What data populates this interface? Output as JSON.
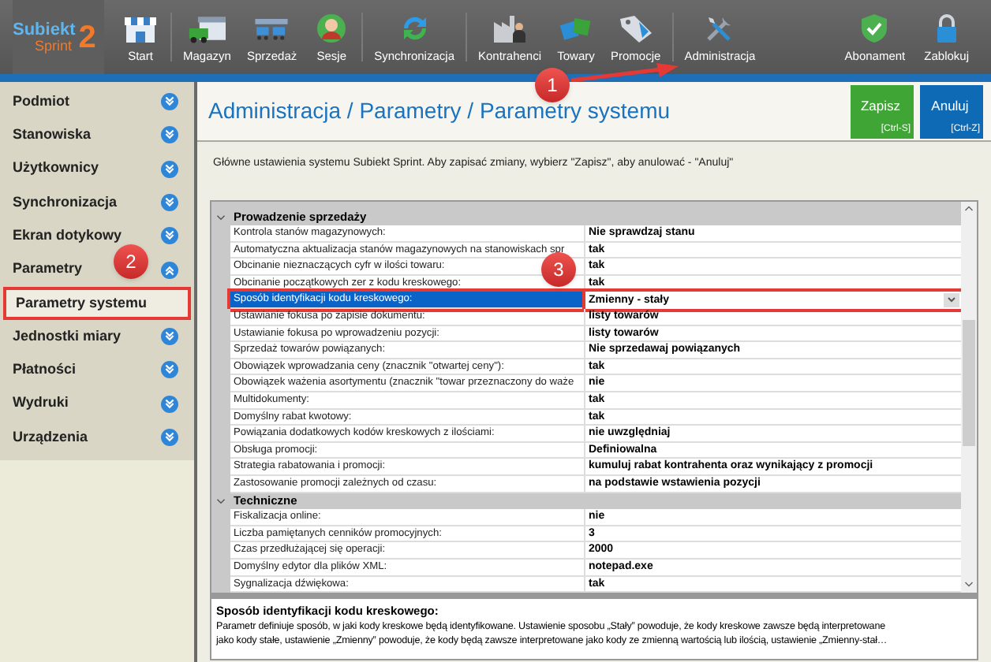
{
  "app": {
    "logo_name": "Subiekt",
    "logo_sub": "Sprint",
    "logo_version": "2"
  },
  "toolbar": [
    {
      "kind": "button",
      "label": "Start"
    },
    {
      "kind": "separator"
    },
    {
      "kind": "button",
      "label": "Magazyn"
    },
    {
      "kind": "button",
      "label": "Sprzedaż"
    },
    {
      "kind": "button",
      "label": "Sesje"
    },
    {
      "kind": "separator"
    },
    {
      "kind": "button",
      "label": "Synchronizacja"
    },
    {
      "kind": "separator"
    },
    {
      "kind": "button",
      "label": "Kontrahenci"
    },
    {
      "kind": "button",
      "label": "Towary"
    },
    {
      "kind": "button",
      "label": "Promocje"
    },
    {
      "kind": "separator"
    },
    {
      "kind": "button",
      "label": "Administracja"
    }
  ],
  "toolbar_right": [
    {
      "label": "Abonament"
    },
    {
      "label": "Zablokuj"
    }
  ],
  "sidebar": {
    "items": [
      {
        "label": "Podmiot",
        "expanded": false
      },
      {
        "label": "Stanowiska",
        "expanded": false
      },
      {
        "label": "Użytkownicy",
        "expanded": false
      },
      {
        "label": "Synchronizacja",
        "expanded": false
      },
      {
        "label": "Ekran dotykowy",
        "expanded": false
      },
      {
        "label": "Parametry",
        "expanded": true,
        "children": [
          {
            "label": "Parametry systemu",
            "selected": true,
            "highlighted": true
          }
        ]
      },
      {
        "label": "Jednostki miary",
        "expanded": false
      },
      {
        "label": "Płatności",
        "expanded": false
      },
      {
        "label": "Wydruki",
        "expanded": false
      },
      {
        "label": "Urządzenia",
        "expanded": false
      }
    ]
  },
  "page": {
    "breadcrumb": "Administracja / Parametry / Parametry systemu",
    "intro": "Główne ustawienia systemu Subiekt Sprint. Aby zapisać zmiany, wybierz \"Zapisz\", aby anulować - \"Anuluj\"",
    "buttons": [
      {
        "kind": "save",
        "label": "Zapisz",
        "shortcut": "[Ctrl-S]"
      },
      {
        "kind": "cancel",
        "label": "Anuluj",
        "shortcut": "[Ctrl-Z]"
      }
    ]
  },
  "property_grid": {
    "groups": [
      {
        "title": "Prowadzenie sprzedaży",
        "expanded": true,
        "rows": [
          {
            "name": "Kontrola stanów magazynowych:",
            "value": "Nie sprawdzaj stanu",
            "selected": false,
            "highlighted": false
          },
          {
            "name": "Automatyczna aktualizacja stanów magazynowych na stanowiskach spr",
            "value": "tak",
            "selected": false,
            "highlighted": false
          },
          {
            "name": "Obcinanie nieznaczących cyfr w ilości towaru:",
            "value": "tak",
            "selected": false,
            "highlighted": false
          },
          {
            "name": "Obcinanie początkowych zer z kodu kreskowego:",
            "value": "tak",
            "selected": false,
            "highlighted": false
          },
          {
            "name": "Sposób identyfikacji kodu kreskowego:",
            "value": "Zmienny - stały",
            "selected": true,
            "highlighted": true
          },
          {
            "name": "Ustawianie fokusa po zapisie dokumentu:",
            "value": "listy towarów",
            "selected": false,
            "highlighted": false
          },
          {
            "name": "Ustawianie fokusa po wprowadzeniu pozycji:",
            "value": "listy towarów",
            "selected": false,
            "highlighted": false
          },
          {
            "name": "Sprzedaż towarów powiązanych:",
            "value": "Nie sprzedawaj powiązanych",
            "selected": false,
            "highlighted": false
          },
          {
            "name": "Obowiązek wprowadzania ceny (znacznik \"otwartej ceny\"):",
            "value": "tak",
            "selected": false,
            "highlighted": false
          },
          {
            "name": "Obowiązek ważenia asortymentu (znacznik \"towar przeznaczony do waże",
            "value": "nie",
            "selected": false,
            "highlighted": false
          },
          {
            "name": "Multidokumenty:",
            "value": "tak",
            "selected": false,
            "highlighted": false
          },
          {
            "name": "Domyślny rabat kwotowy:",
            "value": "tak",
            "selected": false,
            "highlighted": false
          },
          {
            "name": "Powiązania dodatkowych kodów kreskowych z ilościami:",
            "value": "nie uwzględniaj",
            "selected": false,
            "highlighted": false
          },
          {
            "name": "Obsługa promocji:",
            "value": "Definiowalna",
            "selected": false,
            "highlighted": false
          },
          {
            "name": "Strategia rabatowania i promocji:",
            "value": "kumuluj rabat kontrahenta oraz wynikający z promocji",
            "selected": false,
            "highlighted": false
          },
          {
            "name": "Zastosowanie promocji zależnych od czasu:",
            "value": "na podstawie wstawienia pozycji",
            "selected": false,
            "highlighted": false
          }
        ]
      },
      {
        "title": "Techniczne",
        "expanded": true,
        "rows": [
          {
            "name": "Fiskalizacja online:",
            "value": "nie",
            "selected": false,
            "highlighted": false
          },
          {
            "name": "Liczba pamiętanych cenników promocyjnych:",
            "value": "3",
            "selected": false,
            "highlighted": false
          },
          {
            "name": "Czas przedłużającej się operacji:",
            "value": "2000",
            "selected": false,
            "highlighted": false
          },
          {
            "name": "Domyślny edytor dla plików XML:",
            "value": "notepad.exe",
            "selected": false,
            "highlighted": false
          },
          {
            "name": "Sygnalizacja dźwiękowa:",
            "value": "tak",
            "selected": false,
            "highlighted": false
          }
        ]
      }
    ]
  },
  "description": {
    "title": "Sposób identyfikacji kodu kreskowego:",
    "lines": [
      "Parametr definiuje sposób, w jaki kody kreskowe będą identyfikowane. Ustawienie sposobu „Stały” powoduje, że kody kreskowe zawsze będą interpretowane",
      "jako kody stałe, ustawienie „Zmienny” powoduje, że kody będą zawsze interpretowane jako kody ze zmienną wartością lub ilością, ustawienie „Zmienny-stał…"
    ]
  },
  "callouts": [
    {
      "number": "1"
    },
    {
      "number": "2"
    },
    {
      "number": "3"
    }
  ]
}
